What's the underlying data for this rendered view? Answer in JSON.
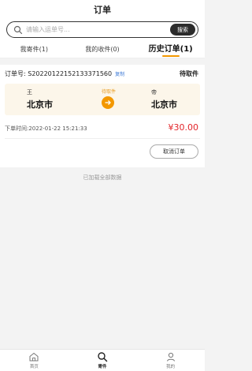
{
  "header": {
    "title": "订单"
  },
  "search": {
    "placeholder": "请输入运单号...",
    "button_label": "搜索",
    "icon": "search-icon"
  },
  "tabs": [
    {
      "label": "我寄件(1)",
      "active": false
    },
    {
      "label": "我的收件(0)",
      "active": false
    },
    {
      "label": "历史订单(1)",
      "active": true
    }
  ],
  "order": {
    "number_label": "订单号: S20220122152133371560",
    "copy_label": "复制",
    "status": "待取件",
    "sender_name": "王",
    "sender_city": "北京市",
    "route_status": "待取件",
    "receiver_name": "帝",
    "receiver_city": "北京市",
    "time_label": "下单时间:2022-01-22 15:21:33",
    "price": "¥30.00",
    "cancel_label": "取消订单"
  },
  "list_end_text": "已加载全部数据",
  "bottom_nav": [
    {
      "label": "首页",
      "icon": "home-icon",
      "active": false
    },
    {
      "label": "寄件",
      "icon": "send-search-icon",
      "active": true
    },
    {
      "label": "我的",
      "icon": "user-icon",
      "active": false
    }
  ],
  "colors": {
    "accent": "#f39800",
    "price": "#e3262b",
    "route_bg": "#fcf6ea",
    "link": "#3c79d6"
  }
}
